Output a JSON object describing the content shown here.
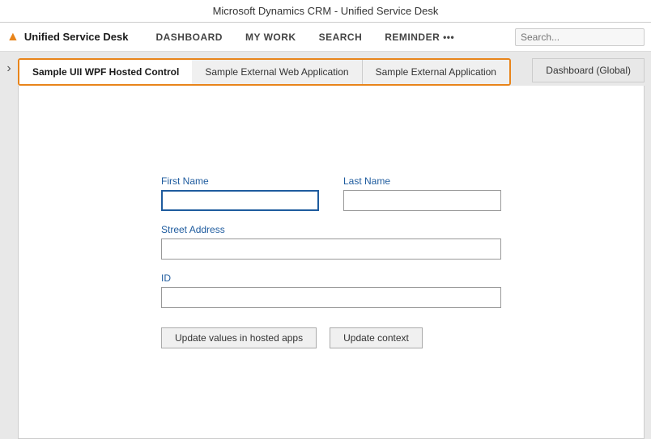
{
  "titleBar": {
    "label": "Microsoft Dynamics CRM - Unified Service Desk"
  },
  "topNav": {
    "appTitle": "Unified Service Desk",
    "navItems": [
      {
        "id": "dashboard",
        "label": "DASHBOARD"
      },
      {
        "id": "mywork",
        "label": "MY WORK"
      },
      {
        "id": "search",
        "label": "SEARCH"
      },
      {
        "id": "reminder",
        "label": "REMINDER •••"
      }
    ]
  },
  "tabs": {
    "groupTabs": [
      {
        "id": "wpf",
        "label": "Sample UII WPF Hosted Control",
        "active": true
      },
      {
        "id": "webApp",
        "label": "Sample External Web Application",
        "active": false
      },
      {
        "id": "extApp",
        "label": "Sample External Application",
        "active": false
      }
    ],
    "rightTab": {
      "id": "dashboard-global",
      "label": "Dashboard (Global)"
    }
  },
  "form": {
    "firstNameLabel": "First Name",
    "lastNameLabel": "Last Name",
    "streetAddressLabel": "Street Address",
    "idLabel": "ID",
    "firstNameValue": "",
    "lastNameValue": "",
    "streetAddressValue": "",
    "idValue": "",
    "button1Label": "Update values in hosted apps",
    "button2Label": "Update context"
  },
  "sidebar": {
    "arrowIcon": "›"
  },
  "icons": {
    "flameIcon": "🔥",
    "logoUnicode": "▲"
  }
}
